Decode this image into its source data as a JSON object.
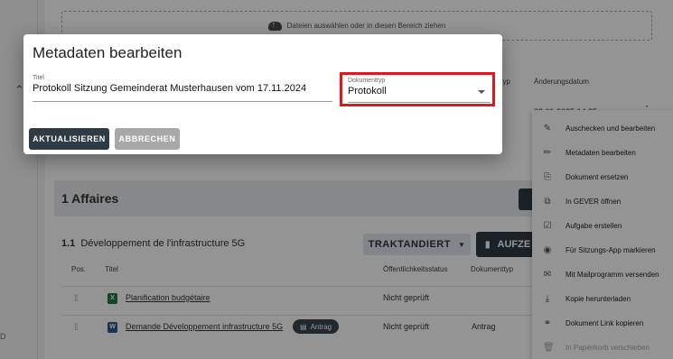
{
  "dropzone": {
    "text": "Dateien auswählen oder in diesen Bereich ziehen"
  },
  "documents_table": {
    "col_typ_partial": "ttyp",
    "col_changed": "Änderungsdatum",
    "row_date_partial": "03.01.2025 14:25"
  },
  "affaires": {
    "title": "1 Affaires"
  },
  "agenda_item": {
    "number": "1.1",
    "title": "Développement de l'infrastructure 5G",
    "status_label": "TRAKTANDIERT",
    "action_label": "AUFZE"
  },
  "table": {
    "headers": {
      "pos": "Pos.",
      "title": "Titel",
      "status": "Öffentlichkeitsstatus",
      "doctype": "Dokumenttyp"
    },
    "rows": [
      {
        "file_icon": "excel-icon",
        "title": "Planification budgétaire",
        "status": "Nicht geprüft",
        "doctype": ""
      },
      {
        "file_icon": "word-icon",
        "title": "Demande Développement infrastructure 5G",
        "badge": "Antrag",
        "status": "Nicht geprüft",
        "doctype": "Antrag"
      }
    ]
  },
  "context_menu": {
    "items": [
      {
        "label": "Auschecken und bearbeiten",
        "icon": "checkout-edit-icon",
        "disabled": false
      },
      {
        "label": "Metadaten bearbeiten",
        "icon": "pencil-icon",
        "disabled": false
      },
      {
        "label": "Dokument ersetzen",
        "icon": "replace-file-icon",
        "disabled": false
      },
      {
        "label": "In GEVER öffnen",
        "icon": "open-external-icon",
        "disabled": false
      },
      {
        "label": "Aufgabe erstellen",
        "icon": "task-icon",
        "disabled": false
      },
      {
        "label": "Für Sitzungs-App markieren",
        "icon": "eye-icon",
        "disabled": false
      },
      {
        "label": "Mit Mailprogramm versenden",
        "icon": "mail-icon",
        "disabled": false
      },
      {
        "label": "Kopie herunterladen",
        "icon": "download-icon",
        "disabled": false
      },
      {
        "label": "Dokument Link kopieren",
        "icon": "link-icon",
        "disabled": false
      },
      {
        "label": "In Papierkorb verschieben",
        "icon": "trash-icon",
        "disabled": true
      }
    ]
  },
  "dialog": {
    "title": "Metadaten bearbeiten",
    "titel_label": "Titel",
    "titel_value": "Protokoll Sitzung Gemeinderat Musterhausen vom 17.11.2024",
    "doctype_label": "Dokumenttyp",
    "doctype_value": "Protokoll",
    "update_button": "AKTUALISIEREN",
    "cancel_button": "ABBRECHEN"
  },
  "colors": {
    "primary": "#2f3b44",
    "highlight": "#e0171c",
    "excel": "#1f7a43",
    "word": "#2b5797"
  }
}
